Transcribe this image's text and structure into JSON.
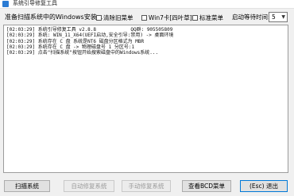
{
  "window": {
    "title": "系统引导修复工具"
  },
  "toolbar": {
    "scan_status": "准备扫描系统中的Windows安装...",
    "options": [
      {
        "label": "清除旧菜单",
        "checked": false
      },
      {
        "label": "Win7卡[四叶草]",
        "checked": false
      },
      {
        "label": "标准菜单",
        "checked": false
      }
    ],
    "wait_label": "启动等待时间:",
    "wait_value": "5"
  },
  "log": {
    "lines": [
      "[02:03:29] 系统引导修复工具 v2.8.8            QQ群: 905505809",
      "[02:03:29] 系统: WIN_11_X64(UEFI启动,安全引导:禁用) -> 桌面环境",
      "[02:03:29] 系统存在 C 盘 系统是NT6 磁盘分区格式为 MBR",
      "[02:03:29] 系统存在 C 盘 -> 物理磁盘号 1 分区号:1",
      "[02:03:29] 点击\"扫描系统\"按钮开始搜索磁盘中的Windows系统..."
    ]
  },
  "buttons": {
    "scan": "扫描系统",
    "auto_repair": "自动修复系统",
    "manual_repair": "手动修复系统",
    "view_bcd": "查看BCD菜单",
    "exit": "(Esc) 退出"
  }
}
